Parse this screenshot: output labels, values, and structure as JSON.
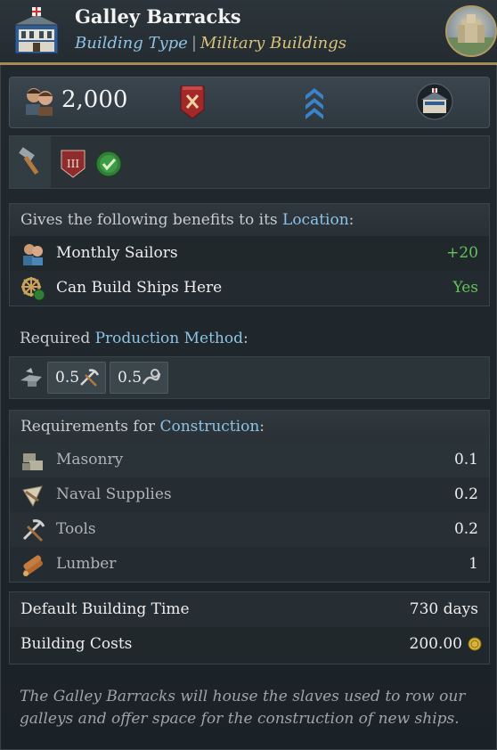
{
  "header": {
    "title": "Galley Barracks",
    "type_label": "Building Type",
    "category": "Military Buildings"
  },
  "stats": {
    "manpower": "2,000"
  },
  "benefits": {
    "prefix": "Gives the following benefits to its ",
    "link": "Location",
    "suffix": ":",
    "rows": [
      {
        "label": "Monthly Sailors",
        "value": "+20",
        "icon": "sailors-icon"
      },
      {
        "label": "Can Build Ships Here",
        "value": "Yes",
        "icon": "ship-wheel-icon"
      }
    ]
  },
  "production": {
    "prefix": "Required ",
    "link": "Production Method",
    "suffix": ":",
    "inputs": [
      {
        "amount": "0.5",
        "icon": "tools-icon"
      },
      {
        "amount": "0.5",
        "icon": "rope-icon"
      }
    ]
  },
  "construction": {
    "prefix": "Requirements for ",
    "link": "Construction",
    "suffix": ":",
    "rows": [
      {
        "label": "Masonry",
        "value": "0.1",
        "icon": "masonry-icon"
      },
      {
        "label": "Naval Supplies",
        "value": "0.2",
        "icon": "naval-supplies-icon"
      },
      {
        "label": "Tools",
        "value": "0.2",
        "icon": "tools-icon"
      },
      {
        "label": "Lumber",
        "value": "1",
        "icon": "lumber-icon"
      }
    ]
  },
  "costs": {
    "time_label": "Default Building Time",
    "time_value": "730 days",
    "cost_label": "Building Costs",
    "cost_value": "200.00"
  },
  "description": "The Galley Barracks will house the slaves used to row our galleys and offer space for the construction of new ships.",
  "colors": {
    "accent_blue": "#8fc3e6",
    "accent_gold": "#d8c27c",
    "positive_green": "#62c25c"
  }
}
